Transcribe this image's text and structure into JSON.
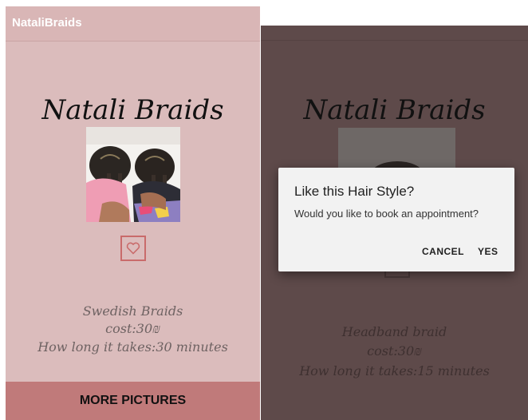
{
  "left_screen": {
    "app_title": "NataliBraids",
    "heading": "Natali Braids",
    "style_name": "Swedish Braids",
    "cost": "cost:30₪",
    "duration": "How long it takes:30 minutes",
    "more_button": "MORE PICTURES",
    "favorite_icon": "heart-outline-icon"
  },
  "right_screen": {
    "heading": "Natali Braids",
    "style_name": "Headband braid",
    "cost": "cost:30₪",
    "duration": "How long it takes:15 minutes",
    "dialog": {
      "title": "Like this Hair Style?",
      "message": "Would you like to book an appointment?",
      "cancel": "CANCEL",
      "yes": "YES"
    }
  }
}
